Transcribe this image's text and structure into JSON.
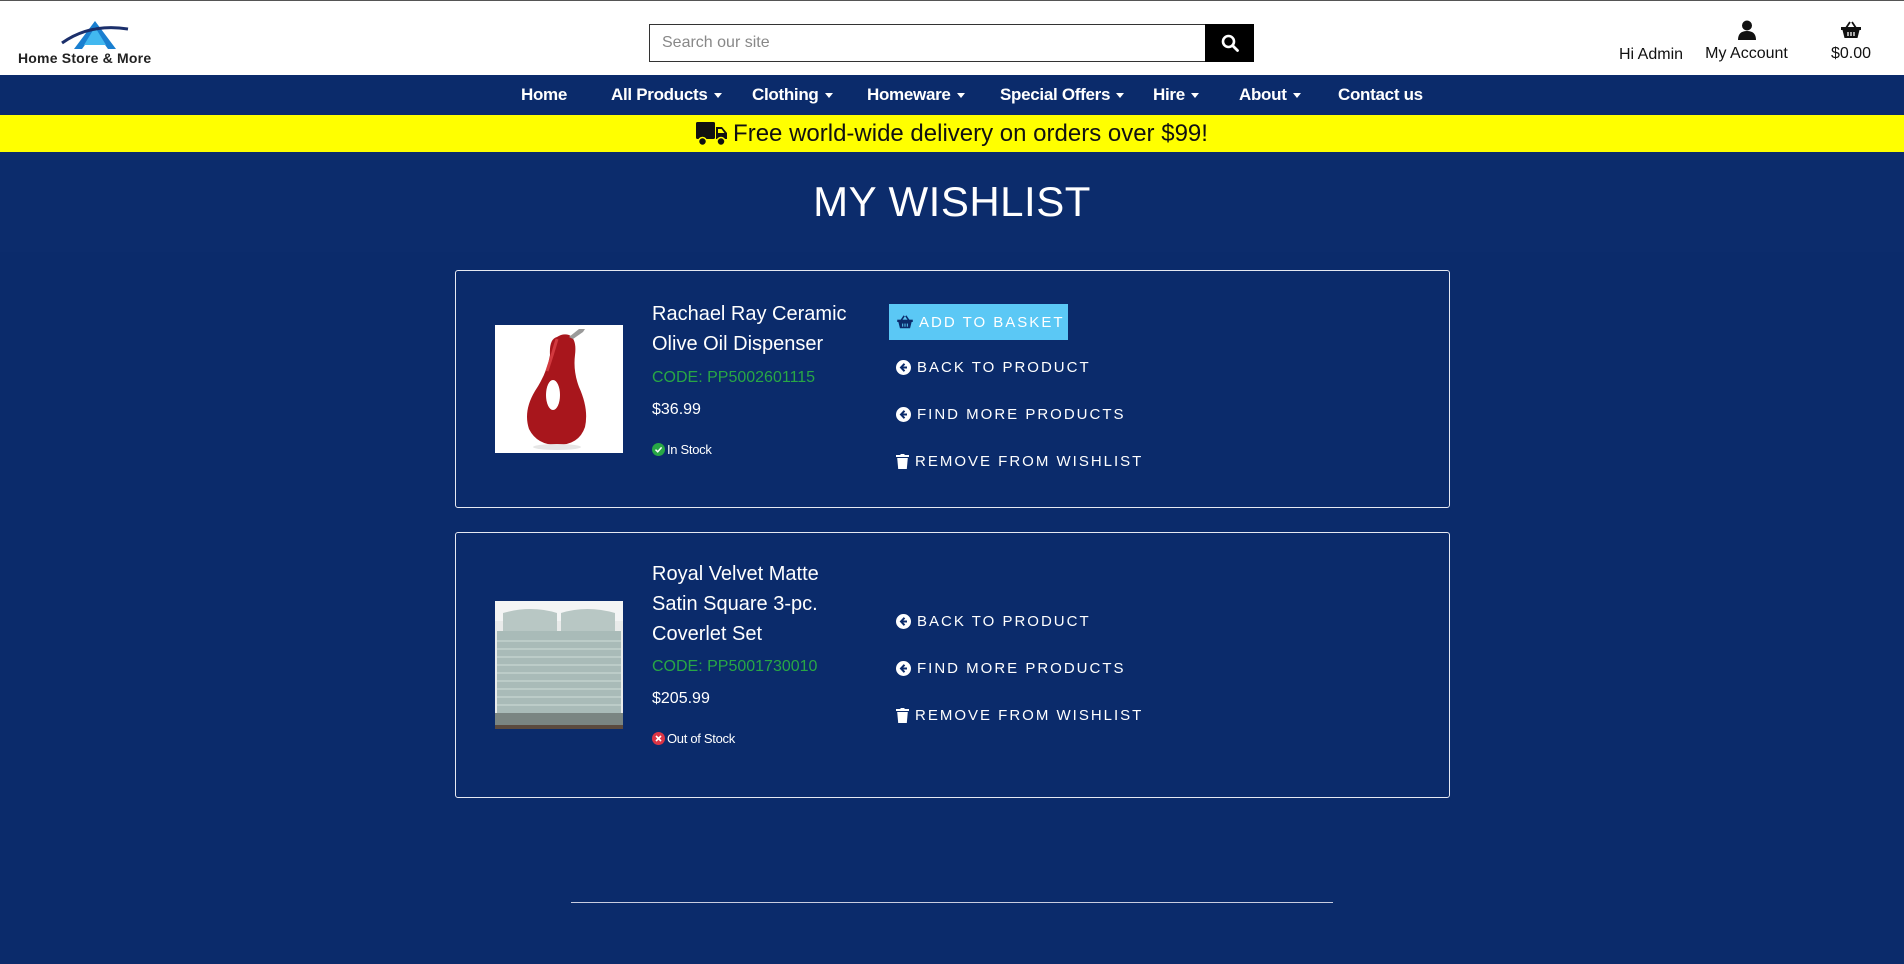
{
  "header": {
    "logo_text": "Home Store & More",
    "search_placeholder": "Search our site",
    "greeting": "Hi Admin",
    "account_label": "My Account",
    "cart_total": "$0.00"
  },
  "nav": [
    {
      "label": "Home",
      "dropdown": false
    },
    {
      "label": "All Products",
      "dropdown": true
    },
    {
      "label": "Clothing",
      "dropdown": true
    },
    {
      "label": "Homeware",
      "dropdown": true
    },
    {
      "label": "Special Offers",
      "dropdown": true
    },
    {
      "label": "Hire",
      "dropdown": true
    },
    {
      "label": "About",
      "dropdown": true
    },
    {
      "label": "Contact us",
      "dropdown": false
    }
  ],
  "promo": {
    "text": "Free world-wide delivery on orders over $99!",
    "icon": "truck-icon",
    "background": "#ffff00"
  },
  "page_title": "MY WISHLIST",
  "colors": {
    "page_bg": "#0b2b6b",
    "accent": "#5bc8f5",
    "code_green": "#28a745",
    "out_red": "#dc3545"
  },
  "wishlist": [
    {
      "name": "Rachael Ray Ceramic Olive Oil Dispenser",
      "code": "CODE: PP5002601115",
      "price": "$36.99",
      "stock": "In Stock",
      "in_stock": true,
      "actions": {
        "add": "ADD TO BASKET",
        "back": "BACK TO PRODUCT",
        "more": "FIND MORE PRODUCTS",
        "remove": "REMOVE FROM WISHLIST"
      }
    },
    {
      "name": "Royal Velvet Matte Satin Square 3-pc. Coverlet Set",
      "code": "CODE: PP5001730010",
      "price": "$205.99",
      "stock": "Out of Stock",
      "in_stock": false,
      "actions": {
        "back": "BACK TO PRODUCT",
        "more": "FIND MORE PRODUCTS",
        "remove": "REMOVE FROM WISHLIST"
      }
    }
  ]
}
